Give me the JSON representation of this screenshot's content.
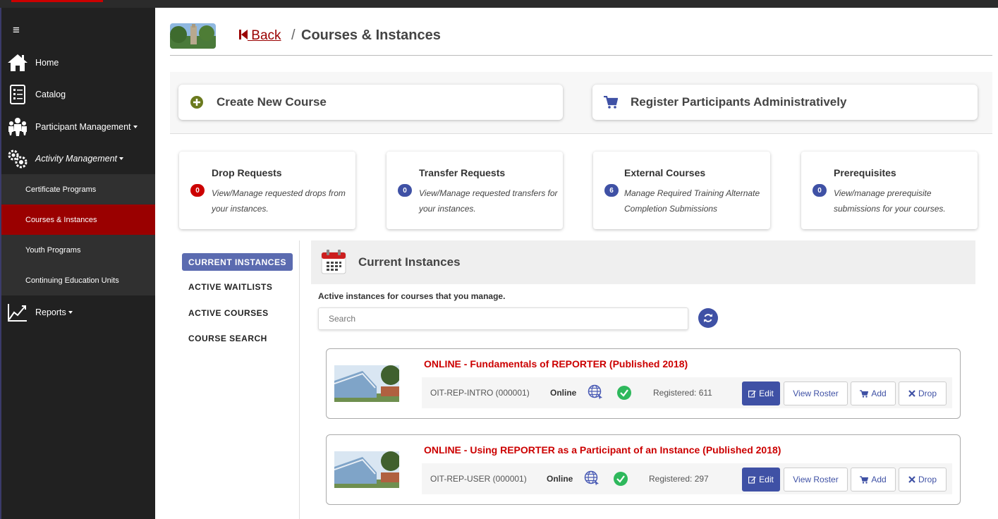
{
  "sidebar": {
    "menu_icon": "≡",
    "items": [
      {
        "label": "Home",
        "icon": "home-icon"
      },
      {
        "label": "Catalog",
        "icon": "catalog-icon"
      },
      {
        "label": "Participant Management",
        "icon": "people-icon"
      },
      {
        "label": "Activity Management",
        "icon": "gears-icon"
      },
      {
        "label": "Reports",
        "icon": "chart-icon"
      }
    ],
    "subitems": [
      {
        "label": "Certificate Programs"
      },
      {
        "label": "Courses & Instances",
        "active": true
      },
      {
        "label": "Youth Programs"
      },
      {
        "label": "Continuing Education Units"
      }
    ]
  },
  "header": {
    "back_label": " Back",
    "separator": "/",
    "title": "Courses & Instances"
  },
  "actions": {
    "create_label": "Create New Course",
    "register_label": "Register Participants Administratively"
  },
  "info_cards": [
    {
      "title": "Drop Requests",
      "count": "0",
      "badge_color": "#cc0000",
      "desc": "View/Manage requested drops from your instances."
    },
    {
      "title": "Transfer Requests",
      "count": "0",
      "badge_color": "#3f51a5",
      "desc": "View/Manage requested transfers for your instances."
    },
    {
      "title": "External Courses",
      "count": "6",
      "badge_color": "#3f51a5",
      "desc": "Manage Required Training Alternate Completion Submissions"
    },
    {
      "title": "Prerequisites",
      "count": "0",
      "badge_color": "#3f51a5",
      "desc": "View/manage prerequisite submissions for your courses."
    }
  ],
  "tabs": [
    "CURRENT INSTANCES",
    "ACTIVE WAITLISTS",
    "ACTIVE COURSES",
    "COURSE SEARCH"
  ],
  "current": {
    "title": "Current Instances",
    "description": "Active instances for courses that you manage.",
    "search_placeholder": "Search"
  },
  "courses": [
    {
      "title": "ONLINE - Fundamentals of REPORTER (Published 2018)",
      "code": "OIT-REP-INTRO (000001)",
      "mode": "Online",
      "registered": "Registered: 611"
    },
    {
      "title": "ONLINE - Using REPORTER as a Participant of an Instance (Published 2018)",
      "code": "OIT-REP-USER (000001)",
      "mode": "Online",
      "registered": "Registered: 297"
    }
  ],
  "buttons": {
    "edit": "Edit",
    "roster": "View Roster",
    "add": "Add",
    "drop": "Drop"
  },
  "colors": {
    "brand": "#9a0000",
    "accent": "#3f51a5",
    "success": "#2eb85c"
  }
}
